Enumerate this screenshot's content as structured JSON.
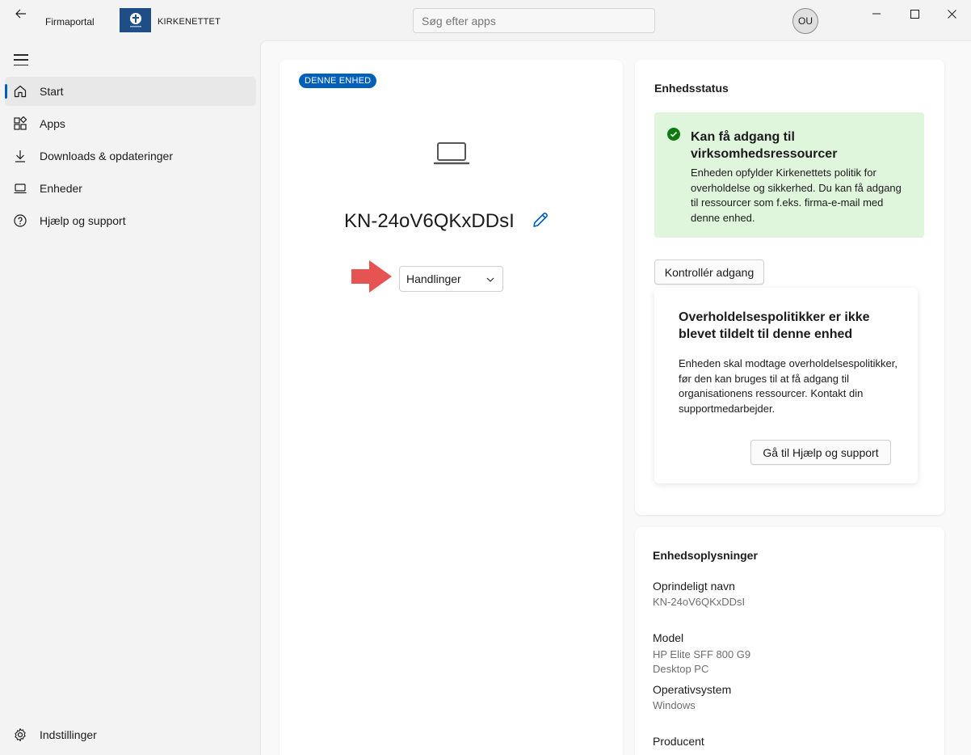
{
  "titlebar": {
    "app_name": "Firmaportal",
    "org_name": "KIRKENETTET",
    "search_placeholder": "Søg efter apps",
    "avatar_initials": "OU"
  },
  "sidebar": {
    "items": [
      {
        "label": "Start",
        "icon": "home-icon",
        "active": true
      },
      {
        "label": "Apps",
        "icon": "apps-grid-icon"
      },
      {
        "label": "Downloads & opdateringer",
        "icon": "download-icon"
      },
      {
        "label": "Enheder",
        "icon": "laptop-icon"
      },
      {
        "label": "Hjælp og support",
        "icon": "help-icon"
      }
    ],
    "settings_label": "Indstillinger"
  },
  "device": {
    "badge": "DENNE ENHED",
    "name": "KN-24oV6QKxDDsI",
    "actions_label": "Handlinger"
  },
  "status": {
    "title": "Enhedsstatus",
    "compliant_heading": "Kan få adgang til virksomhedsressourcer",
    "compliant_body": "Enheden opfylder Kirkenettets politik for overholdelse og sikkerhed. Du kan få adgang til ressourcer som f.eks. firma-e-mail med denne enhed.",
    "check_button": "Kontrollér adgang",
    "policy_heading": "Overholdelsespolitikker er ikke blevet tildelt til denne enhed",
    "policy_body": "Enheden skal modtage overholdelsespolitikker, før den kan bruges til at få adgang til organisationens ressourcer. Kontakt din supportmedarbejder.",
    "help_button": "Gå til Hjælp og support"
  },
  "info": {
    "title": "Enhedsoplysninger",
    "original_name_label": "Oprindeligt navn",
    "original_name_value": "KN-24oV6QKxDDsI",
    "model_label": "Model",
    "model_value_1": "HP Elite SFF 800 G9",
    "model_value_2": "Desktop PC",
    "os_label": "Operativsystem",
    "os_value": "Windows",
    "manufacturer_label": "Producent"
  },
  "colors": {
    "accent": "#005fb8",
    "success_bg": "#dff6dd",
    "success_icon": "#0f7b0f",
    "arrow": "#e55353"
  }
}
